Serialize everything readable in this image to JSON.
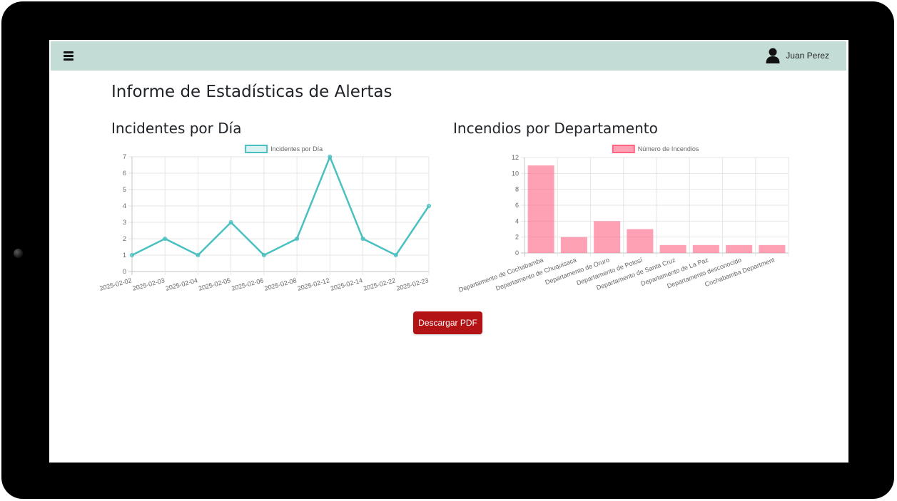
{
  "header": {
    "user_name": "Juan Perez",
    "menu_icon": "hamburger-icon",
    "user_icon": "user-icon",
    "bg_color": "#c3ddd6"
  },
  "page": {
    "title": "Informe de Estadísticas de Alertas"
  },
  "sections": {
    "line_title": "Incidentes por Día",
    "bar_title": "Incendios por Departamento"
  },
  "actions": {
    "download_label": "Descargar PDF",
    "download_color": "#b31315"
  },
  "chart_data": [
    {
      "type": "line",
      "categories": [
        "2025-02-02",
        "2025-02-03",
        "2025-02-04",
        "2025-02-05",
        "2025-02-06",
        "2025-02-08",
        "2025-02-12",
        "2025-02-14",
        "2025-02-22",
        "2025-02-23"
      ],
      "series": [
        {
          "name": "Incidentes por Día",
          "values": [
            1,
            2,
            1,
            3,
            1,
            2,
            7,
            2,
            1,
            4
          ],
          "color": "#4bc0c0"
        }
      ],
      "ylim": [
        0,
        7
      ],
      "yticks": [
        0,
        1,
        2,
        3,
        4,
        5,
        6,
        7
      ],
      "grid": true,
      "legend": "top"
    },
    {
      "type": "bar",
      "categories": [
        "Departamento de Cochabamba",
        "Departamento de Chuquisaca",
        "Departamento de Oruro",
        "Departamento de Potosí",
        "Departamento de Santa Cruz",
        "Departamento de La Paz",
        "Departamento desconocido",
        "Cochabamba Department"
      ],
      "series": [
        {
          "name": "Número de Incendios",
          "values": [
            11,
            2,
            4,
            3,
            1,
            1,
            1,
            1
          ],
          "color": "#ff6384"
        }
      ],
      "ylim": [
        0,
        12
      ],
      "yticks": [
        0,
        2,
        4,
        6,
        8,
        10,
        12
      ],
      "grid": true,
      "legend": "top"
    }
  ]
}
